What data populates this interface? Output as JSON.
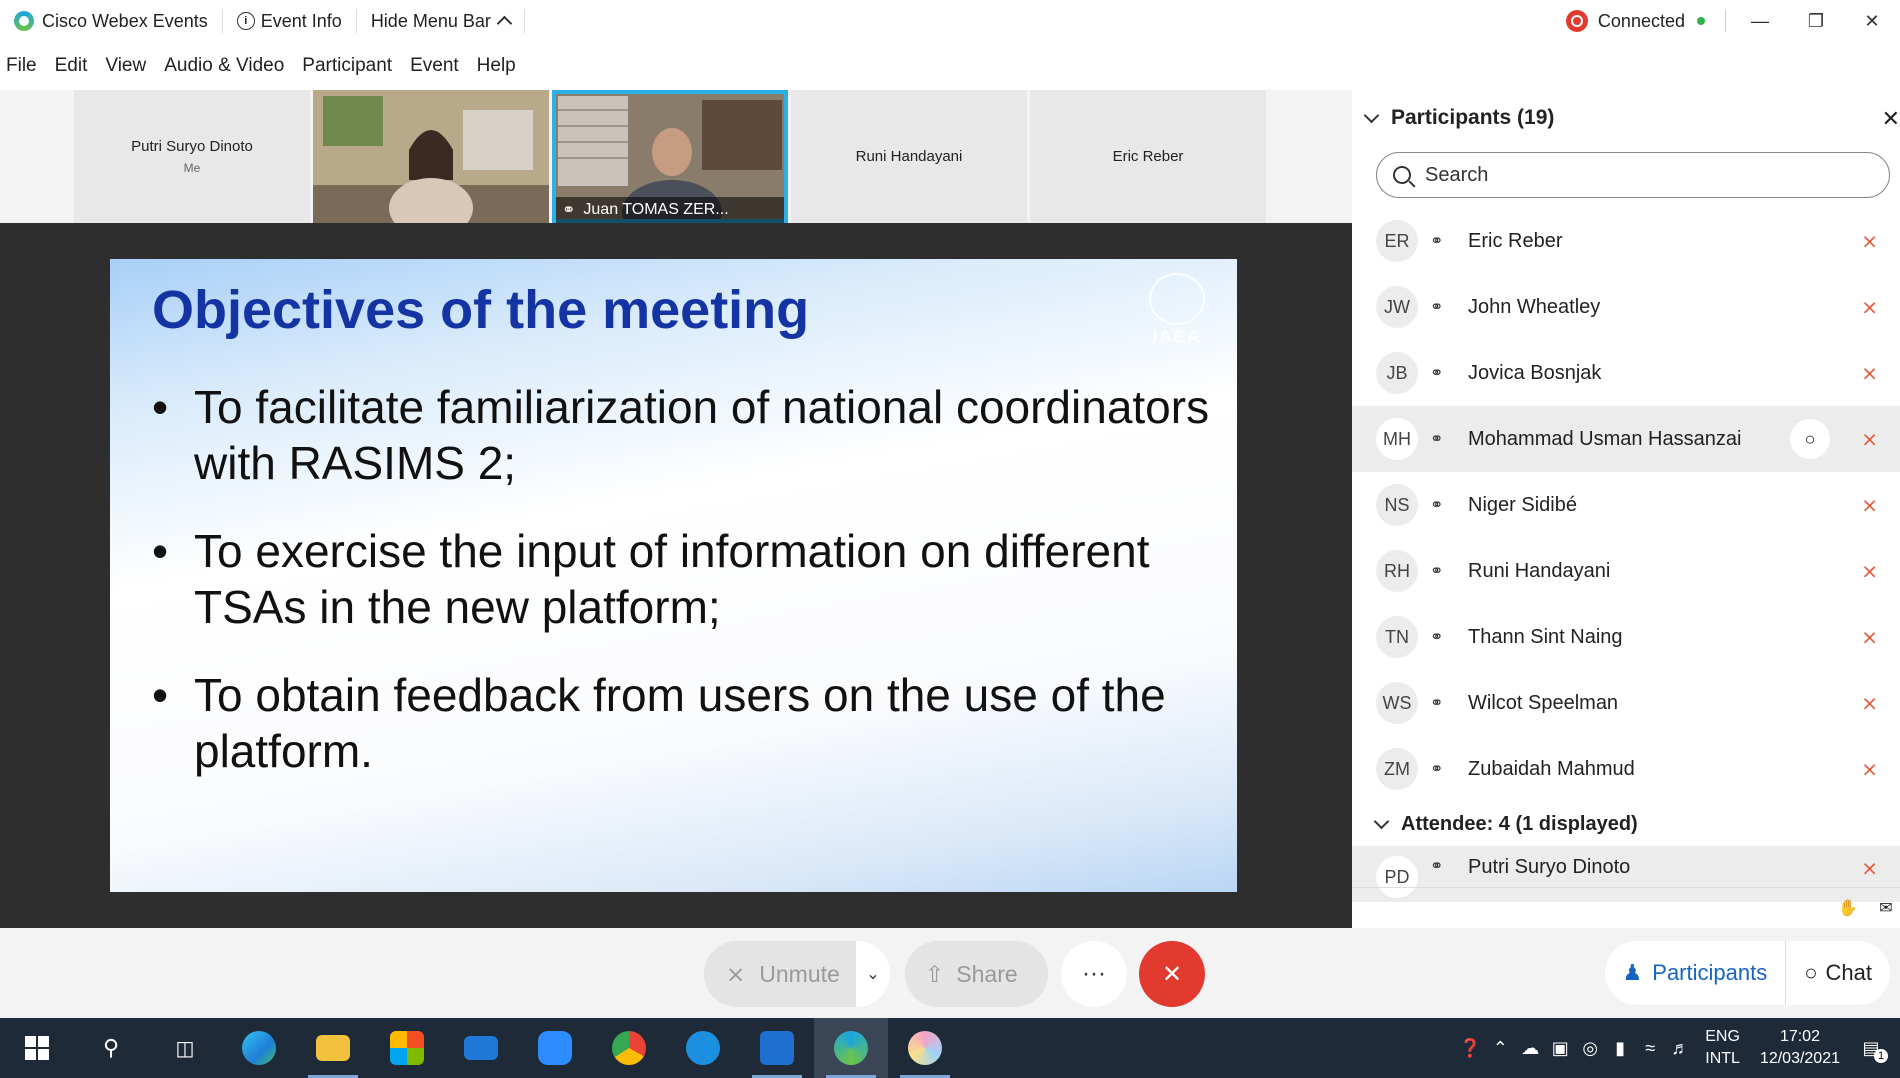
{
  "titlebar": {
    "app_name": "Cisco Webex Events",
    "event_info": "Event Info",
    "hide_menu": "Hide Menu Bar",
    "status": "Connected"
  },
  "menu": [
    "File",
    "Edit",
    "View",
    "Audio & Video",
    "Participant",
    "Event",
    "Help"
  ],
  "video_strip": {
    "tile1_name": "Putri Suryo Dinoto",
    "tile1_sub": "Me",
    "tile3_name": "Juan TOMAS ZER...",
    "tile4_name": "Runi Handayani",
    "tile5_name": "Eric Reber"
  },
  "slide": {
    "title": "Objectives of the meeting",
    "logo_text": "IAEA",
    "bullets": [
      "To facilitate familiarization of national coordinators with RASIMS 2;",
      "To  exercise the input of information on different TSAs in the new platform;",
      "To obtain feedback from users on the use of the platform."
    ]
  },
  "participants_panel": {
    "title": "Participants (19)",
    "search_placeholder": "Search",
    "panelists": [
      {
        "initials": "ER",
        "name": "Eric Reber"
      },
      {
        "initials": "JW",
        "name": "John Wheatley"
      },
      {
        "initials": "JB",
        "name": "Jovica Bosnjak"
      },
      {
        "initials": "MH",
        "name": "Mohammad Usman Hassanzai"
      },
      {
        "initials": "NS",
        "name": "Niger Sidibé"
      },
      {
        "initials": "RH",
        "name": "Runi Handayani"
      },
      {
        "initials": "TN",
        "name": "Thann Sint Naing"
      },
      {
        "initials": "WS",
        "name": "Wilcot Speelman"
      },
      {
        "initials": "ZM",
        "name": "Zubaidah Mahmud"
      }
    ],
    "attendee_header": "Attendee: 4 (1 displayed)",
    "attendees": [
      {
        "initials": "PD",
        "name": "Putri Suryo Dinoto"
      }
    ]
  },
  "controls": {
    "unmute": "Unmute",
    "share": "Share",
    "more": "···",
    "participants_tab": "Participants",
    "chat_tab": "Chat"
  },
  "taskbar": {
    "lang_top": "ENG",
    "lang_bottom": "INTL",
    "time": "17:02",
    "date": "12/03/2021",
    "notif_count": "1"
  },
  "colors": {
    "slide_title": "#1434a4",
    "active_speaker_border": "#2bb0e8",
    "end_call": "#e23a2f",
    "participants_tab": "#1565c0",
    "taskbar": "#1f2a38"
  }
}
